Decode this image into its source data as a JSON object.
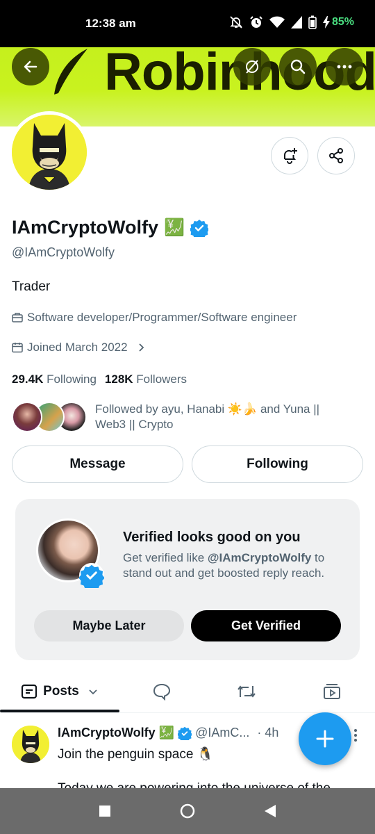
{
  "status_bar": {
    "time": "12:38 am",
    "battery": "85%",
    "icons": [
      "bell-off-icon",
      "alarm-icon",
      "wifi-icon",
      "signal-icon",
      "battery-icon",
      "charging-icon"
    ]
  },
  "banner": {
    "wordmark": "Robinhood",
    "color": "#c9f21f"
  },
  "header_buttons": [
    "back-arrow-icon",
    "hide-icon",
    "search-icon",
    "more-icon"
  ],
  "profile": {
    "name": "IAmCryptoWolfy",
    "name_emoji": "💹",
    "handle": "@IAmCryptoWolfy",
    "bio": "Trader",
    "profession": "Software developer/Programmer/Software engineer",
    "joined": "Joined March 2022",
    "following_count": "29.4K",
    "following_label": "Following",
    "followers_count": "128K",
    "followers_label": "Followers",
    "followed_by": "Followed by ayu, Hanabi ☀️🍌 and Yuna || Web3 || Crypto"
  },
  "actions": {
    "message": "Message",
    "following": "Following"
  },
  "verify_card": {
    "title": "Verified looks good on you",
    "desc_prefix": "Get verified like ",
    "desc_handle": "@IAmCryptoWolfy",
    "desc_suffix": " to stand out and get boosted reply reach.",
    "maybe_later": "Maybe Later",
    "get_verified": "Get Verified"
  },
  "tabs": {
    "posts": "Posts",
    "icons": [
      "posts-icon",
      "replies-icon",
      "reposts-icon",
      "media-icon"
    ]
  },
  "tweet": {
    "name": "IAmCryptoWolfy",
    "emoji": "💹",
    "handle": "@IAmC...",
    "time": "· 4h",
    "text": "Join the penguin space 🐧",
    "text2": "Today we are powering into the universe of the"
  },
  "colors": {
    "accent": "#1d9bf0",
    "battery": "#4ade80",
    "banner": "#c9f21f"
  }
}
